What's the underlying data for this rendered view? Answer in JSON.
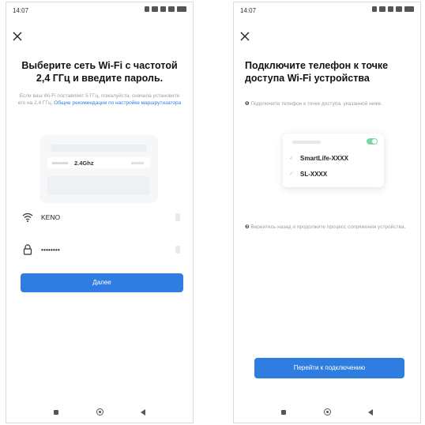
{
  "status_bar": {
    "left_time": "14:07",
    "right_time": "14:07"
  },
  "left_screen": {
    "title": "Выберите сеть Wi-Fi с частотой 2,4 ГГц и введите пароль.",
    "help_text": "Если ваш Wi-Fi поставляет 5 ГГц, пожалуйста, сначала установите его на 2,4 ГГц.",
    "help_link": "Общие рекомендации по настройке маршрутизатора",
    "router_band_label": "2.4Ghz",
    "ssid_value": "KENO",
    "password_value": "••••••••",
    "next_button_label": "Далее"
  },
  "right_screen": {
    "title": "Подключите телефон к точке доступа Wi-Fi устройства",
    "note_1": "Подключите телефон к точке доступа, указанной ниже.",
    "wifi_list": [
      "SmartLife-XXXX",
      "SL-XXXX"
    ],
    "note_2": "Вернитесь назад и продолжите процесс сопряжения устройства.",
    "connect_button_label": "Перейти к подключению"
  },
  "colors": {
    "accent": "#2f7de1",
    "toggle_on": "#7bd8a6"
  },
  "icons": {
    "close": "close-icon",
    "wifi": "wifi-icon",
    "lock": "lock-icon"
  }
}
